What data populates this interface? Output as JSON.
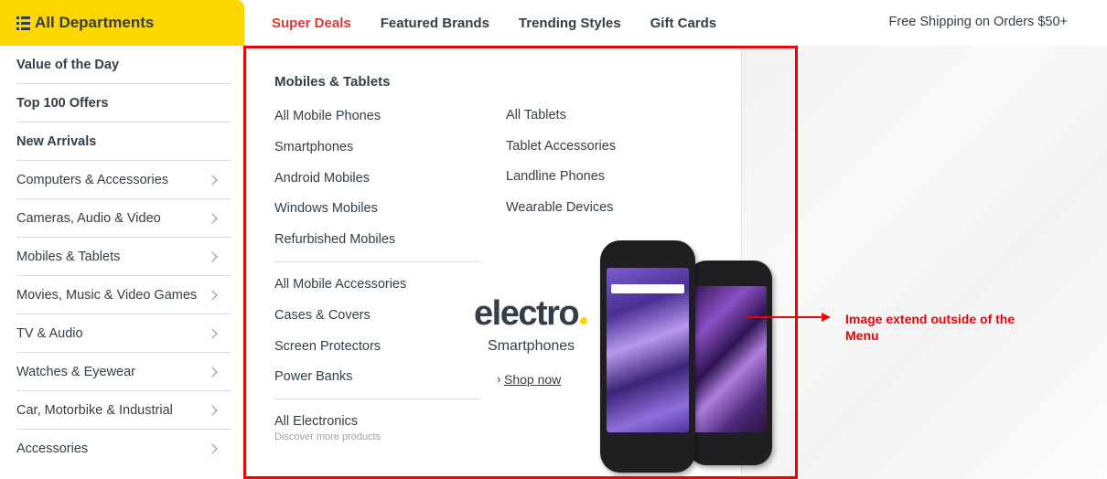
{
  "header": {
    "departments_label": "All Departments",
    "nav": [
      "Super Deals",
      "Featured Brands",
      "Trending Styles",
      "Gift Cards"
    ],
    "free_shipping": "Free Shipping on Orders $50+"
  },
  "sidebar": {
    "items": [
      {
        "label": "Value of the Day"
      },
      {
        "label": "Top 100 Offers"
      },
      {
        "label": "New Arrivals"
      },
      {
        "label": "Computers & Accessories"
      },
      {
        "label": "Cameras, Audio & Video"
      },
      {
        "label": "Mobiles & Tablets"
      },
      {
        "label": "Movies, Music & Video Games"
      },
      {
        "label": "TV & Audio"
      },
      {
        "label": "Watches & Eyewear"
      },
      {
        "label": "Car, Motorbike & Industrial"
      },
      {
        "label": "Accessories"
      }
    ]
  },
  "mega_menu": {
    "title": "Mobiles & Tablets",
    "col1_group1": [
      "All Mobile Phones",
      "Smartphones",
      "Android Mobiles",
      "Windows Mobiles",
      "Refurbished Mobiles"
    ],
    "col1_group2": [
      "All Mobile Accessories",
      "Cases & Covers",
      "Screen Protectors",
      "Power Banks"
    ],
    "col1_group3": {
      "label": "All Electronics",
      "sub": "Discover more products"
    },
    "col2": [
      "All Tablets",
      "Tablet Accessories",
      "Landline Phones",
      "Wearable Devices"
    ]
  },
  "promo": {
    "brand": "electro",
    "subtitle": "Smartphones",
    "cta": "Shop now"
  },
  "annotation": {
    "text": "Image extend outside of the Menu",
    "color": "#ee0000"
  },
  "colors": {
    "accent": "#fed700",
    "deal": "#df3737",
    "text": "#333e48"
  }
}
